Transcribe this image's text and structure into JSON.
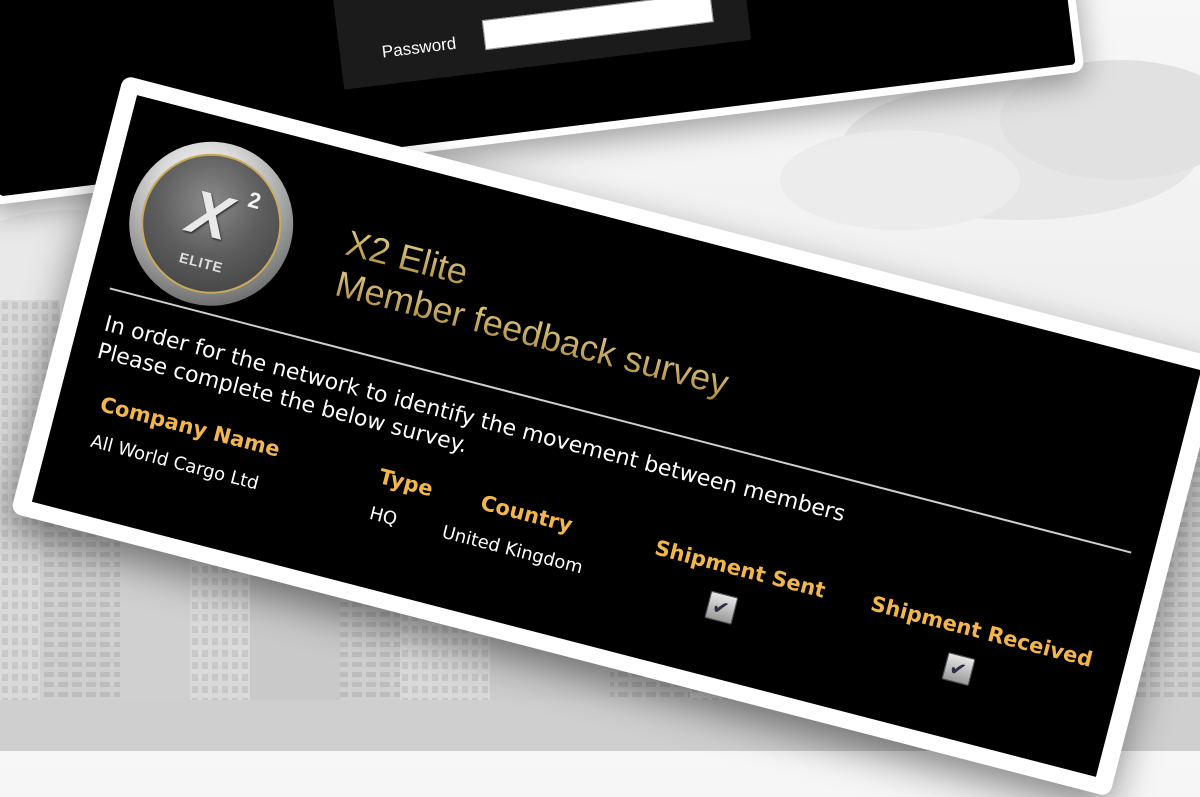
{
  "login": {
    "password_label": "Password"
  },
  "survey": {
    "logo": {
      "mark": "X",
      "superscript": "2",
      "caption": "ELITE"
    },
    "title_line_1": "X2 Elite",
    "title_line_2": "Member feedback survey",
    "intro_line_1": "In order for the network to identify the movement between members",
    "intro_line_2": "Please complete the below survey.",
    "fields": {
      "company_label": "Company Name",
      "company_value": "All World Cargo Ltd",
      "type_label": "Type",
      "type_value": "HQ",
      "country_label": "Country",
      "country_value": "United Kingdom",
      "sent_label": "Shipment Sent",
      "sent_checked": true,
      "received_label": "Shipment Received",
      "received_checked": true
    }
  },
  "colors": {
    "accent_label": "#f3b64b",
    "title_gold": "#c3a65a",
    "card_bg": "#000000",
    "checkmark": "#2b2f4a"
  },
  "icons": {
    "checkbox": "check-icon",
    "logo": "x2-elite-logo"
  }
}
